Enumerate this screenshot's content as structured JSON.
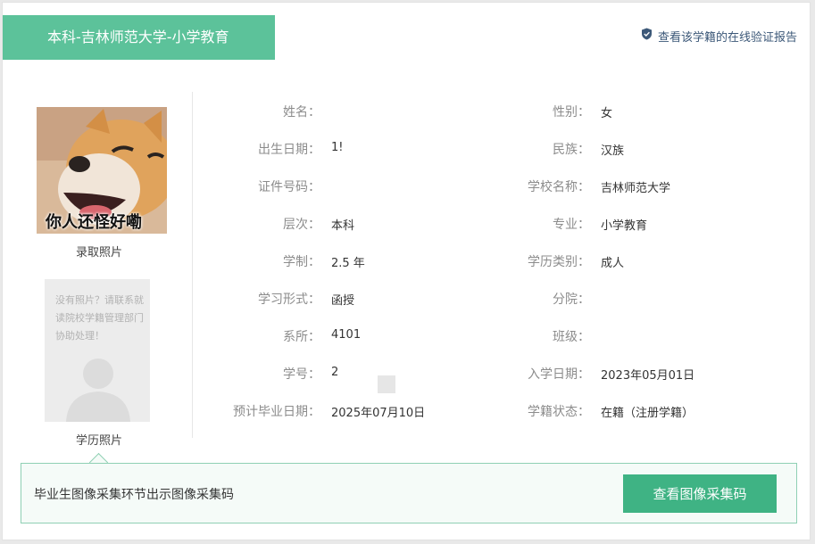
{
  "header": {
    "tab_title": "本科-吉林师范大学-小学教育",
    "verify_link": "查看该学籍的在线验证报告"
  },
  "photos": {
    "admission_photo_caption": "录取照片",
    "admission_photo_text": "你人还怪好嘞",
    "placeholder_text": "没有照片？请联系就读院校学籍管理部门协助处理！",
    "degree_photo_caption": "学历照片"
  },
  "fields_left": [
    {
      "label": "姓名：",
      "value": ""
    },
    {
      "label": "出生日期：",
      "value": "1!"
    },
    {
      "label": "证件号码：",
      "value": ""
    },
    {
      "label": "层次：",
      "value": "本科"
    },
    {
      "label": "学制：",
      "value": "2.5 年"
    },
    {
      "label": "学习形式：",
      "value": "函授"
    },
    {
      "label": "系所：",
      "value": "4101"
    },
    {
      "label": "学号：",
      "value": "2"
    },
    {
      "label": "预计毕业日期：",
      "value": "2025年07月10日"
    }
  ],
  "fields_right": [
    {
      "label": "性别：",
      "value": "女"
    },
    {
      "label": "民族：",
      "value": "汉族"
    },
    {
      "label": "学校名称：",
      "value": "吉林师范大学"
    },
    {
      "label": "专业：",
      "value": "小学教育"
    },
    {
      "label": "学历类别：",
      "value": "成人"
    },
    {
      "label": "分院：",
      "value": ""
    },
    {
      "label": "班级：",
      "value": ""
    },
    {
      "label": "入学日期：",
      "value": "2023年05月01日"
    },
    {
      "label": "学籍状态：",
      "value": "在籍（注册学籍）"
    }
  ],
  "notice": {
    "text": "毕业生图像采集环节出示图像采集码",
    "button": "查看图像采集码"
  },
  "colors": {
    "accent_green": "#5cc29a",
    "button_green": "#3fb384",
    "link_blue": "#3c5878"
  }
}
